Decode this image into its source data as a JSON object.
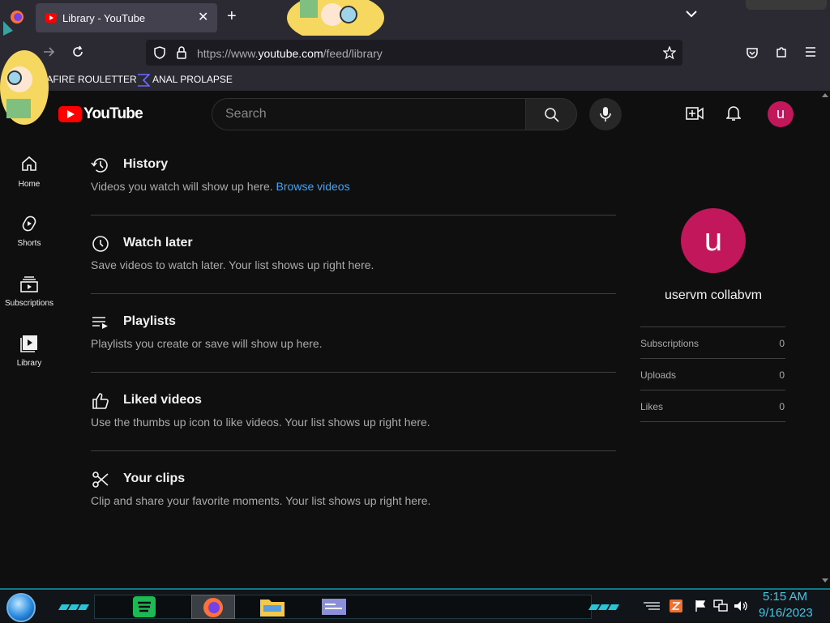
{
  "browser": {
    "tab_title": "Library - YouTube",
    "url_prefix": "https://www.",
    "url_host": "youtube.com",
    "url_path": "/feed/library",
    "bookmarks": [
      "IAFIRE ROULETTER",
      "ANAL PROLAPSE"
    ]
  },
  "youtube": {
    "logo_text": "YouTube",
    "search_placeholder": "Search",
    "avatar_letter": "u",
    "rail": [
      "Home",
      "Shorts",
      "Subscriptions",
      "Library"
    ],
    "sections": [
      {
        "title": "History",
        "desc": "Videos you watch will show up here.",
        "link": "Browse videos"
      },
      {
        "title": "Watch later",
        "desc": "Save videos to watch later. Your list shows up right here."
      },
      {
        "title": "Playlists",
        "desc": "Playlists you create or save will show up here."
      },
      {
        "title": "Liked videos",
        "desc": "Use the thumbs up icon to like videos. Your list shows up right here."
      },
      {
        "title": "Your clips",
        "desc": "Clip and share your favorite moments. Your list shows up right here."
      }
    ],
    "profile": {
      "name": "uservm collabvm",
      "stats": [
        {
          "label": "Subscriptions",
          "value": "0"
        },
        {
          "label": "Uploads",
          "value": "0"
        },
        {
          "label": "Likes",
          "value": "0"
        }
      ]
    }
  },
  "taskbar": {
    "time": "5:15 AM",
    "date": "9/16/2023",
    "accent": "#27c6d6"
  }
}
